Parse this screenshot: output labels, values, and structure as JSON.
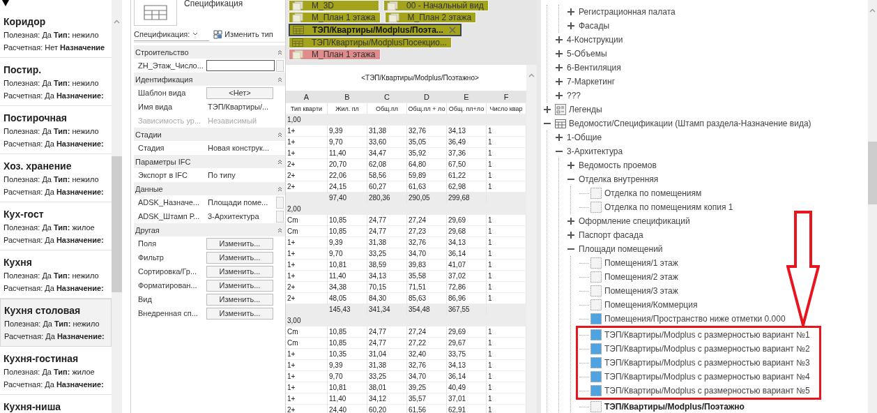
{
  "room_list": {
    "items": [
      {
        "title": "Коридор",
        "selected": false,
        "lines": [
          "Полезная: Да **Тип:** нежило",
          "Расчетная: Нет **Назначение**"
        ]
      },
      {
        "title": "Постир.",
        "selected": false,
        "lines": [
          "Полезная: Да **Тип:** нежило",
          "Расчетная: Да **Назначение:**"
        ]
      },
      {
        "title": "Постирочная",
        "selected": false,
        "lines": [
          "Полезная: Да **Тип:** нежило",
          "Расчетная: Да **Назначение:**"
        ]
      },
      {
        "title": "Хоз. хранение",
        "selected": false,
        "lines": [
          "Полезная: Да **Тип:** нежило",
          "Расчетная: Да **Назначение:**"
        ]
      },
      {
        "title": "Кух-гост",
        "selected": false,
        "lines": [
          "Полезная: Да **Тип:** жилое",
          "Расчетная: Да **Назначение:**"
        ]
      },
      {
        "title": "Кухня",
        "selected": false,
        "lines": [
          "Полезная: Да **Тип:** нежило",
          "Расчетная: Да **Назначение:**"
        ]
      },
      {
        "title": "Кухня столовая",
        "selected": true,
        "lines": [
          "Полезная: Да **Тип:** нежило",
          "Расчетная: Да **Назначение:**"
        ]
      },
      {
        "title": "Кухня-гостиная",
        "selected": false,
        "lines": [
          "Полезная: Да **Тип:** жилое",
          "Расчетная: Да **Назначение:**"
        ]
      },
      {
        "title": "Кухня-ниша",
        "selected": false
      }
    ]
  },
  "properties": {
    "type_name": "Спецификация",
    "selector": "Спецификация:",
    "edit_type": "Изменить тип",
    "groups": [
      {
        "title": "Строительство",
        "expanded": true,
        "rows": [
          {
            "label": "ZH_Этаж_Числo...",
            "kind": "input",
            "disabled": false,
            "browse": true
          }
        ]
      },
      {
        "title": "Идентификация",
        "expanded": true,
        "rows": [
          {
            "label": "Шаблон вида",
            "kind": "button",
            "value": "<Нет>",
            "disabled": false,
            "browse": false
          },
          {
            "label": "Имя вида",
            "kind": "text",
            "value": "ТЭП/Квартиры/...",
            "disabled": false,
            "browse": false
          },
          {
            "label": "Зависимость ур...",
            "kind": "text",
            "value": "Независимый",
            "disabled": true,
            "browse": false
          }
        ]
      },
      {
        "title": "Стадии",
        "expanded": true,
        "rows": [
          {
            "label": "Стадия",
            "kind": "text",
            "value": "Новая конструк...",
            "disabled": false,
            "browse": false
          }
        ]
      },
      {
        "title": "Параметры IFC",
        "expanded": true,
        "rows": [
          {
            "label": "Экспорт в IFC",
            "kind": "text",
            "value": "По типу",
            "disabled": false,
            "browse": false
          }
        ]
      },
      {
        "title": "Данные",
        "expanded": true,
        "rows": [
          {
            "label": "ADSK_Назначе...",
            "kind": "text",
            "value": "Площади поме...",
            "disabled": false,
            "browse": true
          },
          {
            "label": "ADSK_Штамп Р...",
            "kind": "text",
            "value": "3-Архитектура",
            "disabled": false,
            "browse": true
          }
        ]
      },
      {
        "title": "Другая",
        "expanded": true,
        "rows": [
          {
            "label": "Поля",
            "kind": "button",
            "value": "Изменить...",
            "disabled": false,
            "browse": false
          },
          {
            "label": "Фильтр",
            "kind": "button",
            "value": "Изменить...",
            "disabled": false,
            "browse": false
          },
          {
            "label": "Сортировка/Гр...",
            "kind": "button",
            "value": "Изменить...",
            "disabled": false,
            "browse": false
          },
          {
            "label": "Форматирован...",
            "kind": "button",
            "value": "Изменить...",
            "disabled": false,
            "browse": false
          },
          {
            "label": "Вид",
            "kind": "button",
            "value": "Изменить...",
            "disabled": false,
            "browse": false
          },
          {
            "label": "Внедренная сп...",
            "kind": "button",
            "value": "Изменить...",
            "disabled": false,
            "browse": false
          }
        ]
      }
    ]
  },
  "schedule_view": {
    "tab_rows": [
      [
        {
          "label": "М_3D",
          "kind": "plan",
          "color": "#a3a31c",
          "selected": false
        },
        {
          "label": "00 - Начальный вид",
          "kind": "plan",
          "color": "#a3a31c",
          "selected": false
        }
      ],
      [
        {
          "label": "М_План 1 этажа",
          "kind": "plan",
          "color": "#a3a31c",
          "selected": false
        },
        {
          "label": "М_План 2 этажа",
          "kind": "plan",
          "color": "#a3a31c",
          "selected": false
        }
      ],
      [
        {
          "label": "ТЭП/Квартиры/Modplus/Поэта...",
          "kind": "schedule",
          "color": "#a3a31c",
          "selected": true
        }
      ],
      [
        {
          "label": "ТЭП/Квартиры/ModplusПосекцио...",
          "kind": "schedule",
          "color": "#a3a31c",
          "selected": false
        }
      ],
      [
        {
          "label": "М_План 1 этажа",
          "kind": "plan",
          "color": "#e08c8c",
          "selected": false
        }
      ]
    ],
    "schedule": {
      "title": "<ТЭП/Квартиры/Modplus/Поэтажно>",
      "columns": [
        "A",
        "B",
        "C",
        "D",
        "E",
        "F"
      ],
      "headings": [
        "Тип кварти",
        "Жил. пл",
        "Общ.пл",
        "Общ.пл + ло",
        "Общ. пл+ло",
        "Число квар"
      ],
      "rows": [
        {
          "kind": "group",
          "label": "1,00"
        },
        {
          "kind": "data",
          "cells": [
            "1+",
            "9,39",
            "31,38",
            "32,76",
            "34,13",
            "1"
          ]
        },
        {
          "kind": "data",
          "cells": [
            "1+",
            "9,70",
            "33,60",
            "35,05",
            "36,49",
            "1"
          ]
        },
        {
          "kind": "data",
          "cells": [
            "1+",
            "11,40",
            "34,47",
            "35,92",
            "37,36",
            "1"
          ]
        },
        {
          "kind": "data",
          "cells": [
            "2+",
            "20,70",
            "62,08",
            "64,80",
            "67,50",
            "1"
          ]
        },
        {
          "kind": "data",
          "cells": [
            "2+",
            "22,06",
            "58,56",
            "59,89",
            "61,22",
            "1"
          ]
        },
        {
          "kind": "data",
          "cells": [
            "2+",
            "24,15",
            "60,27",
            "61,63",
            "62,98",
            "1"
          ]
        },
        {
          "kind": "total",
          "cells": [
            "97,40",
            "280,36",
            "290,05",
            "299,68"
          ]
        },
        {
          "kind": "group",
          "label": "2,00"
        },
        {
          "kind": "data",
          "cells": [
            "Cm",
            "10,85",
            "24,77",
            "27,24",
            "29,69",
            "1"
          ]
        },
        {
          "kind": "data",
          "cells": [
            "Cm",
            "10,85",
            "24,77",
            "27,23",
            "29,68",
            "1"
          ]
        },
        {
          "kind": "data",
          "cells": [
            "1+",
            "9,39",
            "31,38",
            "32,76",
            "34,13",
            "1"
          ]
        },
        {
          "kind": "data",
          "cells": [
            "1+",
            "9,70",
            "33,25",
            "34,70",
            "36,14",
            "1"
          ]
        },
        {
          "kind": "data",
          "cells": [
            "1+",
            "10,81",
            "38,59",
            "39,83",
            "41,07",
            "1"
          ]
        },
        {
          "kind": "data",
          "cells": [
            "1+",
            "11,40",
            "34,13",
            "35,58",
            "37,02",
            "1"
          ]
        },
        {
          "kind": "data",
          "cells": [
            "2+",
            "34,38",
            "70,15",
            "71,51",
            "72,86",
            "1"
          ]
        },
        {
          "kind": "data",
          "cells": [
            "2+",
            "48,05",
            "84,30",
            "85,63",
            "86,96",
            "1"
          ]
        },
        {
          "kind": "total",
          "cells": [
            "145,43",
            "341,34",
            "354,48",
            "367,55"
          ]
        },
        {
          "kind": "group",
          "label": "3,00"
        },
        {
          "kind": "data",
          "cells": [
            "Cm",
            "10,85",
            "24,77",
            "27,24",
            "29,69",
            "1"
          ]
        },
        {
          "kind": "data",
          "cells": [
            "Cm",
            "10,85",
            "24,77",
            "27,22",
            "29,67",
            "1"
          ]
        },
        {
          "kind": "data",
          "cells": [
            "1+",
            "10,35",
            "31,04",
            "32,40",
            "33,75",
            "1"
          ]
        },
        {
          "kind": "data",
          "cells": [
            "1+",
            "9,39",
            "31,38",
            "32,76",
            "34,13",
            "1"
          ]
        },
        {
          "kind": "data",
          "cells": [
            "1+",
            "9,70",
            "33,25",
            "34,70",
            "36,14",
            "1"
          ]
        },
        {
          "kind": "data",
          "cells": [
            "1+",
            "10,81",
            "38,01",
            "39,25",
            "40,49",
            "1"
          ]
        },
        {
          "kind": "data",
          "cells": [
            "1+",
            "11,40",
            "34,12",
            "35,57",
            "37,01",
            "1"
          ]
        },
        {
          "kind": "data",
          "cells": [
            "2+",
            "24,40",
            "60,20",
            "61,56",
            "62,91",
            "1"
          ]
        }
      ]
    }
  },
  "project_browser": {
    "tree": [
      {
        "children": [
          {
            "children": [
              {
                "label": "Регистрационная палата",
                "expanded": false
              },
              {
                "label": "Фасады",
                "expanded": false
              }
            ]
          },
          {
            "label": "4-Конструкции",
            "expanded": false
          },
          {
            "label": "5-Объемы",
            "expanded": false
          },
          {
            "label": "6-Вентиляция",
            "expanded": false
          },
          {
            "label": "7-Маркетинг",
            "expanded": false
          },
          {
            "label": "???",
            "expanded": false
          }
        ]
      },
      {
        "kind": "legend",
        "label": "Легенды",
        "expanded": false
      },
      {
        "kind": "schedule",
        "label": "Ведомости/Спецификации (Штамп раздела-Назначение вида)",
        "expanded": true,
        "children": [
          {
            "label": "1-Общие",
            "expanded": false
          },
          {
            "label": "3-Архитектура",
            "expanded": true,
            "children": [
              {
                "label": "Ведомость проемов",
                "expanded": false
              },
              {
                "label": "Отделка внутренняя",
                "expanded": true,
                "children": [
                  {
                    "kind": "leaf",
                    "label": "Отделка по помещениям",
                    "filled": false,
                    "active": false,
                    "framed": false
                  },
                  {
                    "kind": "leaf",
                    "label": "Отделка по помещениям копия 1",
                    "filled": false,
                    "active": false,
                    "framed": false
                  }
                ]
              },
              {
                "label": "Оформление спецификаций",
                "expanded": false
              },
              {
                "label": "Паспорт фасада",
                "expanded": false
              },
              {
                "label": "Площади помещений",
                "expanded": true,
                "children": [
                  {
                    "kind": "leaf",
                    "label": "Помещения/1 этаж",
                    "filled": false,
                    "active": false,
                    "framed": false
                  },
                  {
                    "kind": "leaf",
                    "label": "Помещения/2 этаж",
                    "filled": false,
                    "active": false,
                    "framed": false
                  },
                  {
                    "kind": "leaf",
                    "label": "Помещения/3 этаж",
                    "filled": false,
                    "active": false,
                    "framed": false
                  },
                  {
                    "kind": "leaf",
                    "label": "Помещения/Коммерция",
                    "filled": false,
                    "active": false,
                    "framed": false
                  },
                  {
                    "kind": "leaf",
                    "label": "Помещения/Пространство ниже отметки 0.000",
                    "filled": true,
                    "active": false,
                    "framed": false
                  },
                  {
                    "kind": "leaf",
                    "label": "ТЭП/Квартиры/Modplus с размерностью вариант №1",
                    "filled": true,
                    "active": false,
                    "framed": true
                  },
                  {
                    "kind": "leaf",
                    "label": "ТЭП/Квартиры/Modplus с размерностью вариант №2",
                    "filled": true,
                    "active": false,
                    "framed": true
                  },
                  {
                    "kind": "leaf",
                    "label": "ТЭП/Квартиры/Modplus с размерностью вариант №3",
                    "filled": true,
                    "active": false,
                    "framed": true
                  },
                  {
                    "kind": "leaf",
                    "label": "ТЭП/Квартиры/Modplus с размерностью вариант №4",
                    "filled": true,
                    "active": false,
                    "framed": true
                  },
                  {
                    "kind": "leaf",
                    "label": "ТЭП/Квартиры/Modplus с размерностью вариант №5",
                    "filled": true,
                    "active": false,
                    "framed": true
                  },
                  {
                    "kind": "leaf",
                    "label": "ТЭП/Квартиры/Modplus/Поэтажно",
                    "filled": false,
                    "active": true,
                    "framed": false
                  }
                ]
              }
            ]
          }
        ]
      }
    ]
  }
}
